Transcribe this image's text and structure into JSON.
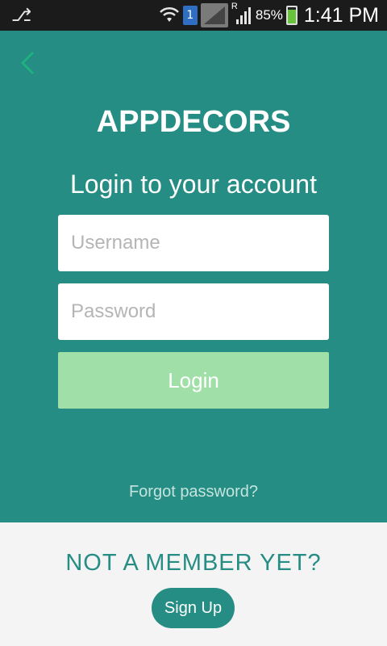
{
  "status_bar": {
    "sim_slot": "1",
    "network_type": "R",
    "battery_percent": "85%",
    "time": "1:41 PM",
    "battery_level": 0.85
  },
  "colors": {
    "primary": "#268d84",
    "login_button": "#a0e0a8",
    "back_icon": "#1fb27f",
    "bottom_background": "#f4f4f4"
  },
  "brand": "APPDECORS",
  "headline": "Login to your account",
  "username": {
    "placeholder": "Username",
    "value": ""
  },
  "password": {
    "placeholder": "Password",
    "value": ""
  },
  "login_label": "Login",
  "forgot_label": "Forgot password?",
  "not_member_label": "NOT A MEMBER YET?",
  "signup_label": "Sign Up"
}
